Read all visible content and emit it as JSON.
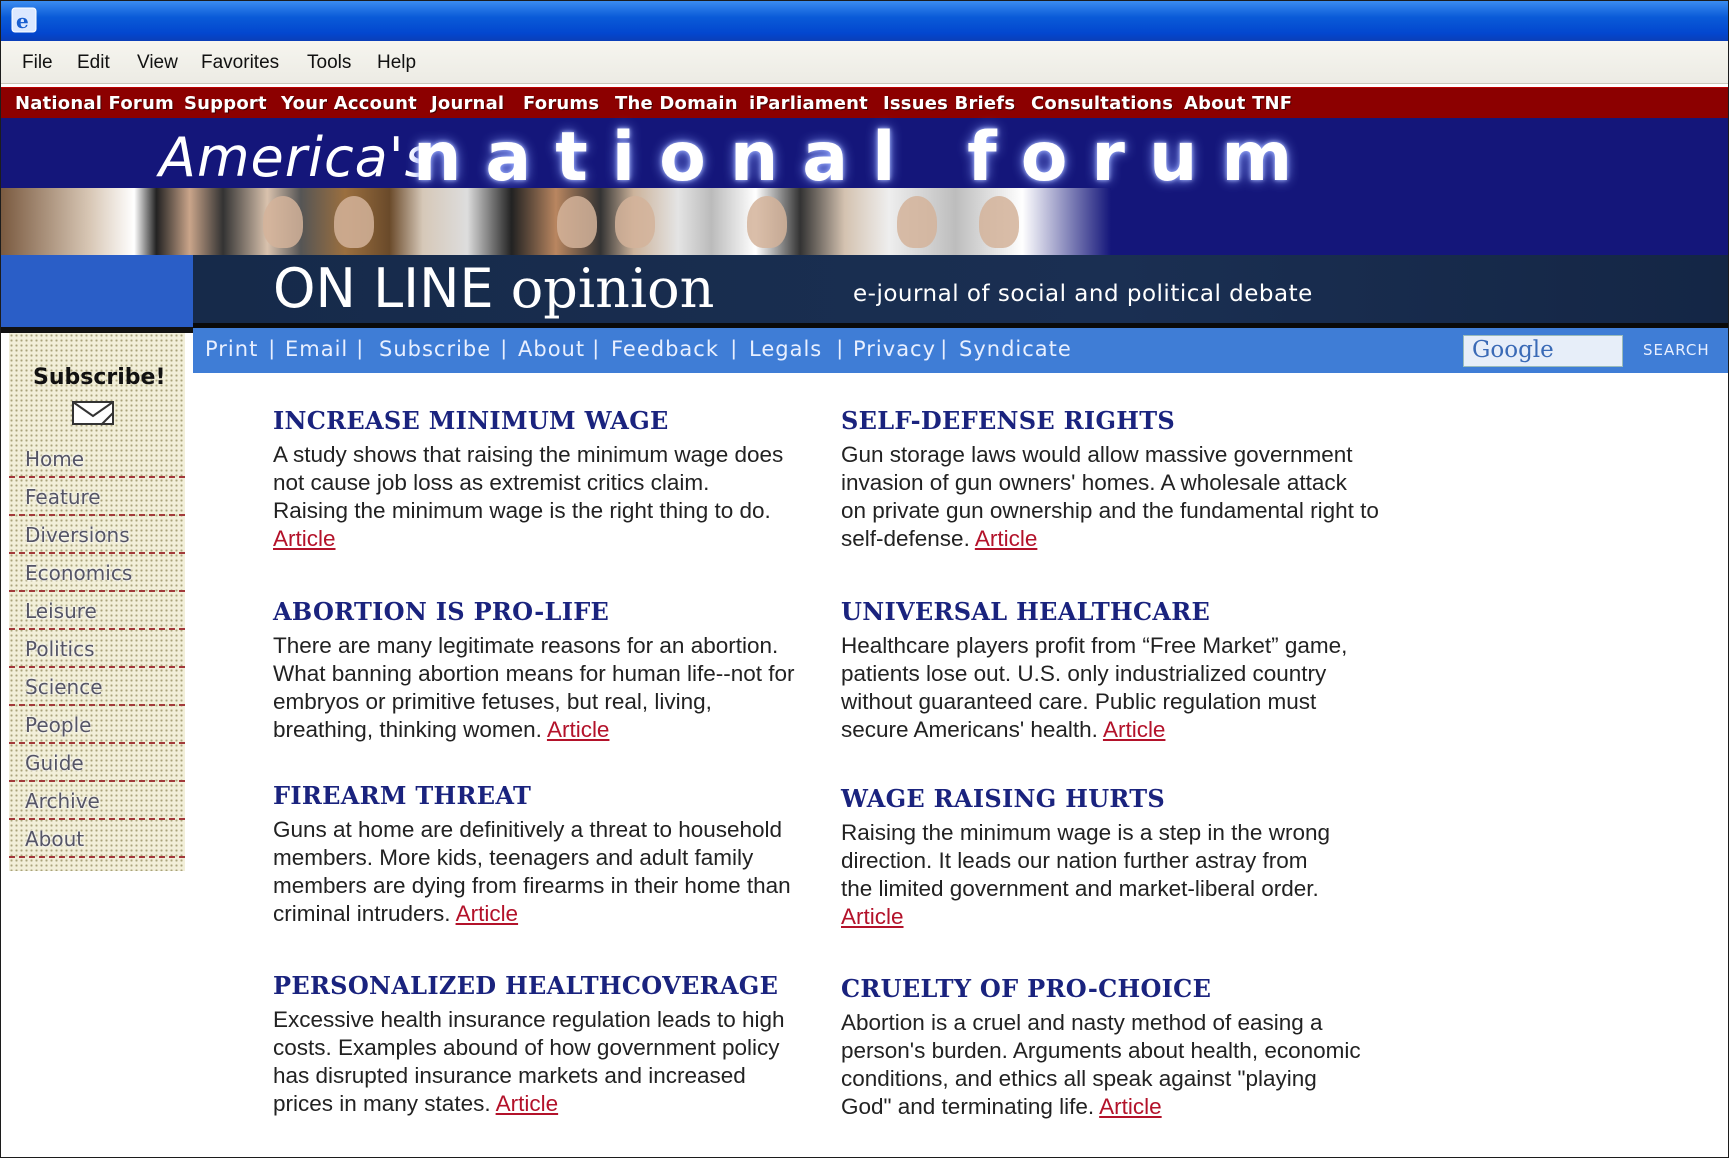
{
  "menubar": [
    "File",
    "Edit",
    "View",
    "Favorites",
    "Tools",
    "Help"
  ],
  "site_nav": [
    "National Forum",
    "Support",
    "Your Account",
    "Journal",
    "Forums",
    "The Domain",
    "iParliament",
    "Issues Briefs",
    "Consultations",
    "About TNF"
  ],
  "banner": {
    "title_prefix": "America's",
    "title_main": "national forum",
    "subtitle": "ON LINE opinion",
    "subtitle_a": "ON LINE",
    "subtitle_b": "opinion",
    "tagline": "e-journal of social and political debate"
  },
  "tools": [
    "Print",
    "Email",
    "Subscribe",
    "About",
    "Feedback",
    "Legals",
    "Privacy",
    "Syndicate"
  ],
  "search": {
    "placeholder": "Google",
    "button": "SEARCH"
  },
  "sidebar": {
    "subscribe_label": "Subscribe!",
    "items": [
      "Home",
      "Feature",
      "Diversions",
      "Economics",
      "Leisure",
      "Politics",
      "Science",
      "People",
      "Guide",
      "Archive",
      "About"
    ]
  },
  "link_color": "#b3122a",
  "heading_color": "#1a237e",
  "articles": [
    {
      "title": "INCREASE MINIMUM WAGE",
      "lines": [
        "A study shows that raising the minimum wage does",
        "not cause job loss as extremist critics claim.",
        "Raising the minimum wage is the right thing to do.",
        ""
      ],
      "link": "Article"
    },
    {
      "title": "SELF-DEFENSE RIGHTS",
      "lines": [
        "Gun storage laws would allow massive government",
        "invasion of gun owners' homes. A wholesale attack",
        "on private gun ownership and the fundamental right to",
        "self-defense. "
      ],
      "link": "Article"
    },
    {
      "title": "ABORTION IS PRO-LIFE",
      "lines": [
        "There are many legitimate reasons for an abortion.",
        "What banning abortion means for human life--not for",
        "embryos or primitive fetuses, but real, living,",
        "breathing, thinking women. "
      ],
      "link": "Article"
    },
    {
      "title": "UNIVERSAL HEALTHCARE",
      "lines": [
        "Healthcare players profit from “Free Market” game,",
        "patients lose out. U.S. only industrialized country",
        "without guaranteed care. Public regulation must",
        "secure Americans' health. "
      ],
      "link": "Article"
    },
    {
      "title": "FIREARM THREAT",
      "lines": [
        "Guns at home are definitively a threat to household",
        "members. More kids, teenagers and adult family",
        "members are dying from firearms in their home than",
        "criminal intruders. "
      ],
      "link": "Article"
    },
    {
      "title": "WAGE RAISING HURTS",
      "lines": [
        "Raising the minimum wage is a step in the wrong",
        "direction. It leads our nation further astray from",
        "the limited government and market-liberal order.",
        ""
      ],
      "link": "Article"
    },
    {
      "title": "PERSONALIZED HEALTHCOVERAGE",
      "lines": [
        "Excessive health insurance regulation leads to high",
        "costs. Examples abound of how government policy",
        "has disrupted insurance markets and increased",
        "prices in many states. "
      ],
      "link": "Article"
    },
    {
      "title": "CRUELTY OF PRO-CHOICE",
      "lines": [
        "Abortion is a cruel and nasty method of easing a",
        "person's burden. Arguments about health, economic",
        "conditions, and ethics all speak against \"playing",
        "God\" and terminating life. "
      ],
      "link": "Article"
    }
  ]
}
